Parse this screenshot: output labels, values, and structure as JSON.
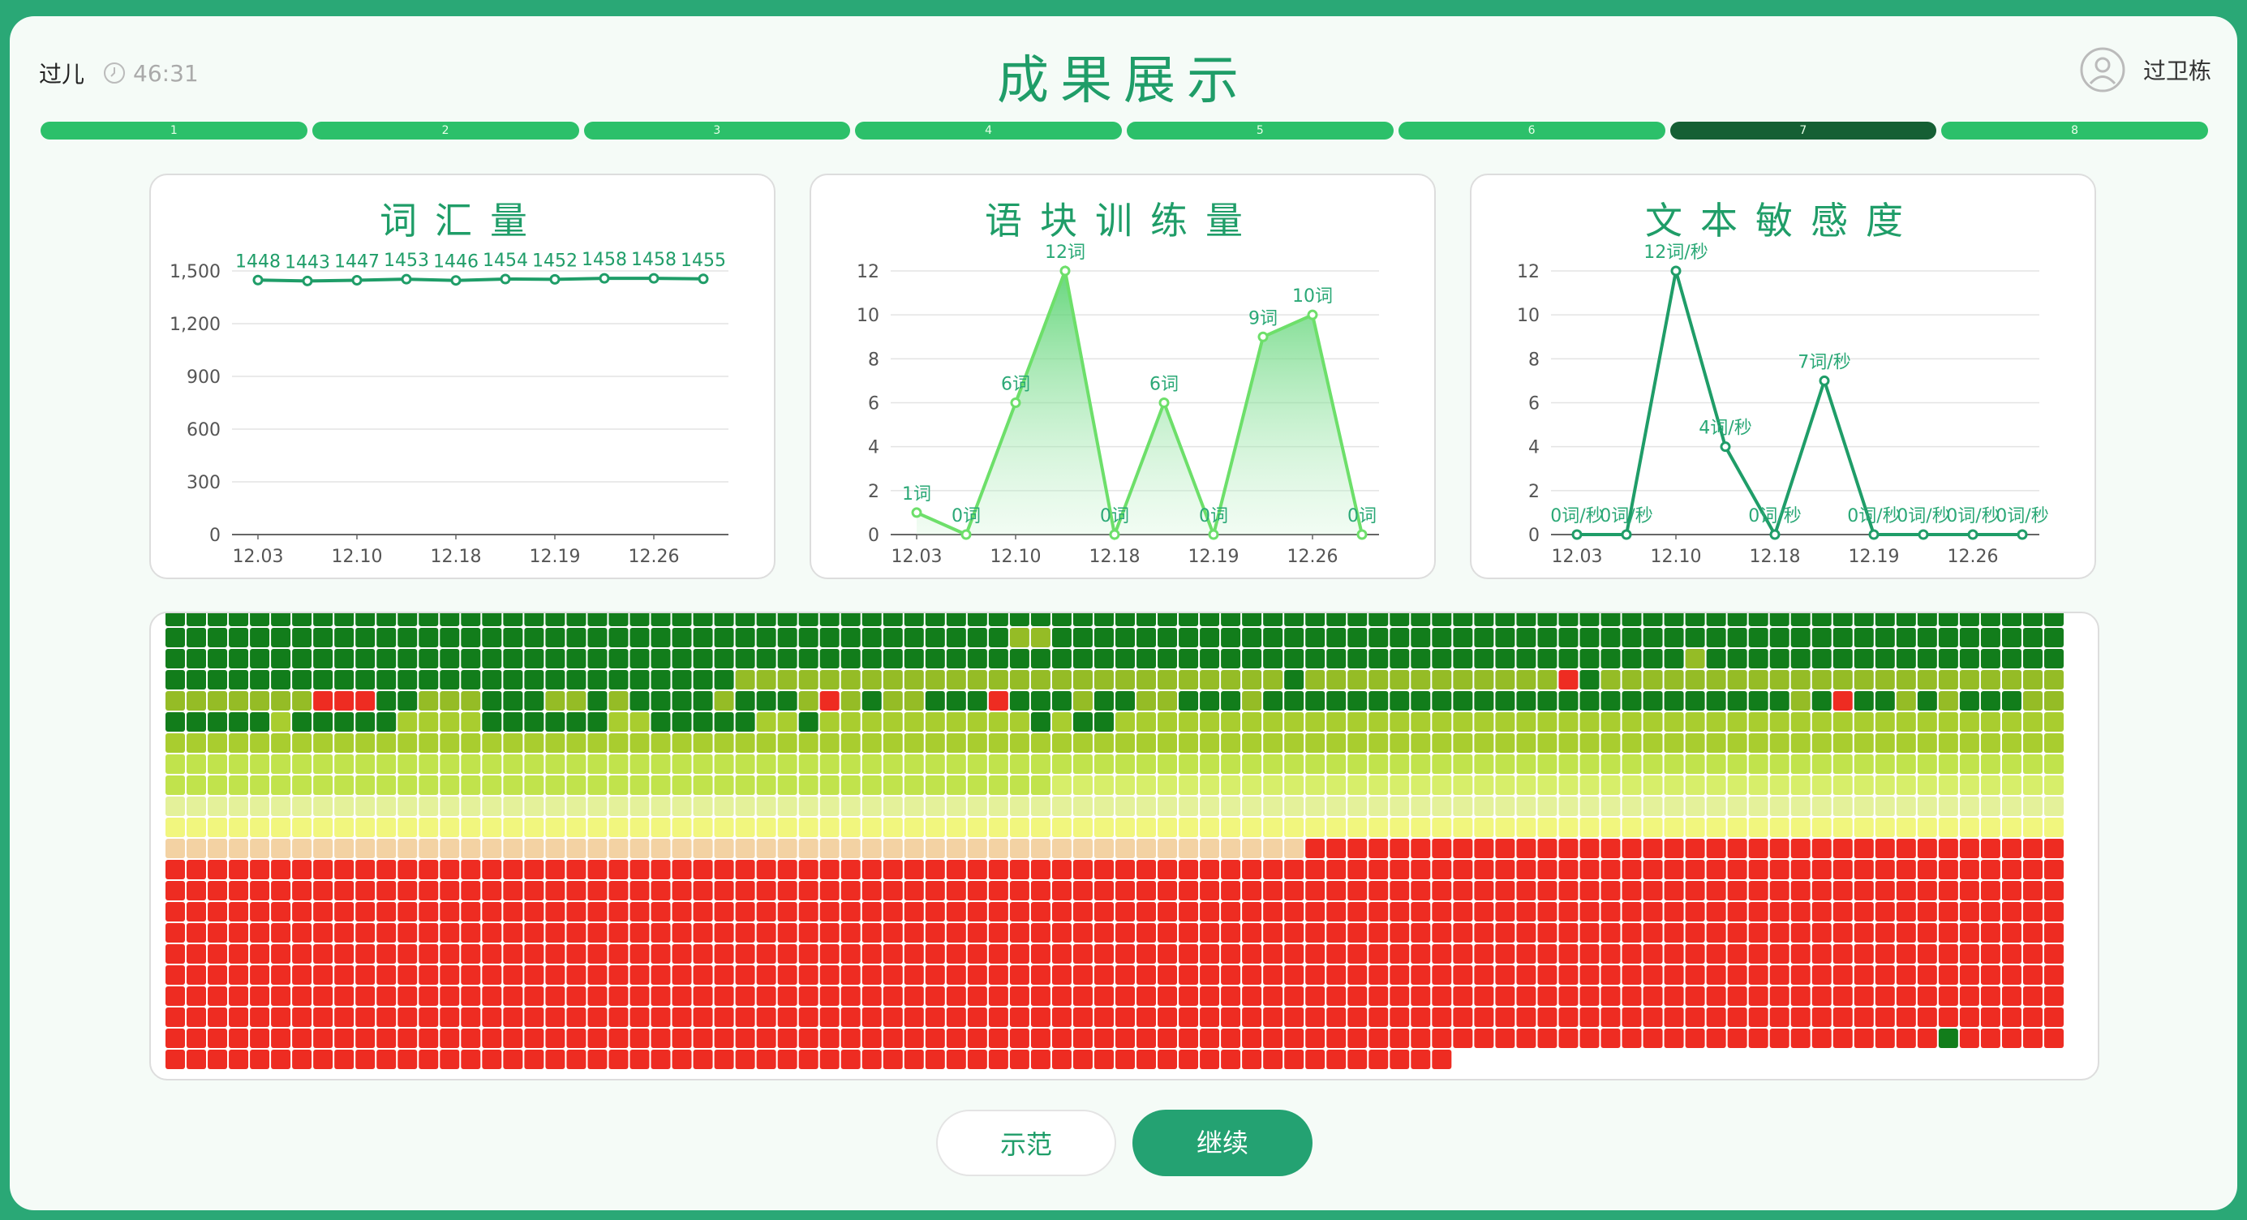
{
  "header": {
    "student_name": "过儿",
    "timer": "46:31",
    "title": "成果展示",
    "teacher_name": "过卫栋"
  },
  "progress": {
    "steps": [
      "1",
      "2",
      "3",
      "4",
      "5",
      "6",
      "7",
      "8"
    ],
    "active_index": 6
  },
  "charts_titles": [
    "词汇量",
    "语块训练量",
    "文本敏感度"
  ],
  "chart_data": [
    {
      "type": "line",
      "title": "词汇量",
      "x_ticks": [
        "12.03",
        "12.10",
        "12.18",
        "12.19",
        "12.26"
      ],
      "values": [
        1448,
        1443,
        1447,
        1453,
        1446,
        1454,
        1452,
        1458,
        1458,
        1455
      ],
      "labels": [
        "1448",
        "1443",
        "1447",
        "1453",
        "1446",
        "1454",
        "1452",
        "1458",
        "1458",
        "1455"
      ],
      "y_ticks": [
        0,
        300,
        600,
        900,
        1200,
        1500
      ],
      "y_tick_labels": [
        "0",
        "300",
        "600",
        "900",
        "1,200",
        "1,500"
      ],
      "ylim": [
        0,
        1500
      ],
      "color": "#1f9d68"
    },
    {
      "type": "area",
      "title": "语块训练量",
      "x_ticks": [
        "12.03",
        "12.10",
        "12.18",
        "12.19",
        "12.26"
      ],
      "values": [
        1,
        0,
        6,
        12,
        0,
        6,
        0,
        9,
        10,
        0
      ],
      "labels": [
        "1词",
        "0词",
        "6词",
        "12词",
        "0词",
        "6词",
        "0词",
        "9词",
        "10词",
        "0词"
      ],
      "y_ticks": [
        0,
        2,
        4,
        6,
        8,
        10,
        12
      ],
      "ylim": [
        0,
        12
      ],
      "color": "#6ddf6a"
    },
    {
      "type": "line",
      "title": "文本敏感度",
      "x_ticks": [
        "12.03",
        "12.10",
        "12.18",
        "12.19",
        "12.26"
      ],
      "values": [
        0,
        0,
        12,
        4,
        0,
        7,
        0,
        0,
        0,
        0
      ],
      "labels": [
        "0词/秒",
        "0词/秒",
        "12词/秒",
        "4词/秒",
        "0词/秒",
        "7词/秒",
        "0词/秒",
        "0词/秒",
        "0词/秒",
        "0词/秒"
      ],
      "y_ticks": [
        0,
        2,
        4,
        6,
        8,
        10,
        12
      ],
      "ylim": [
        0,
        12
      ],
      "color": "#1f9d68"
    }
  ],
  "heatmap": {
    "columns": 90,
    "rows": 22,
    "total_cells": 1951,
    "palette": [
      "#127d1b",
      "#6ea51e",
      "#95bc26",
      "#a9cd2f",
      "#c1e34c",
      "#d7ee6a",
      "#e4f19a",
      "#f1f67e",
      "#f3d2a3",
      "#ee2c22"
    ],
    "special": {
      "r": [
        [
          4,
          7
        ],
        [
          4,
          8
        ],
        [
          4,
          9
        ],
        [
          4,
          31
        ],
        [
          4,
          39
        ],
        [
          3,
          66
        ],
        [
          4,
          79
        ]
      ],
      "g": [
        [
          3,
          16
        ],
        [
          3,
          67
        ],
        [
          2,
          78
        ],
        [
          3,
          53
        ],
        [
          20,
          84
        ]
      ],
      "o": [
        [
          1,
          40
        ],
        [
          1,
          41
        ],
        [
          2,
          72
        ]
      ]
    }
  },
  "buttons": {
    "demo": "示范",
    "continue": "继续"
  },
  "colors": {
    "brand": "#1f9d68",
    "border": "#2aa876",
    "progress": "#2cc06a",
    "progress_active": "#155f34"
  }
}
